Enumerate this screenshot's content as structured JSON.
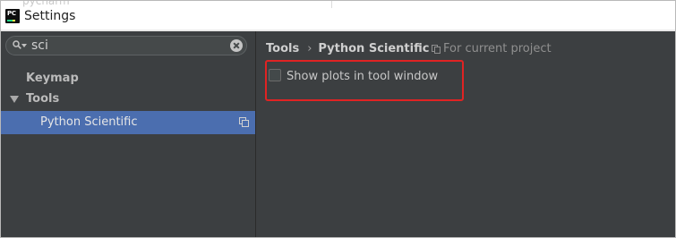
{
  "window": {
    "title": "Settings",
    "app_icon": "pycharm-logo-icon",
    "background_fragment": "pycharm"
  },
  "sidebar": {
    "search": {
      "value": "sci",
      "icons": [
        "search-icon",
        "clear-icon"
      ]
    },
    "items": [
      {
        "label": "Keymap",
        "bold": true,
        "level": 0
      },
      {
        "label": "Tools",
        "bold": true,
        "level": 0,
        "expanded": true
      },
      {
        "label": "Python Scientific",
        "bold": false,
        "level": 1,
        "selected": true,
        "has_copy_icon": true
      }
    ]
  },
  "content": {
    "breadcrumb": {
      "parent": "Tools",
      "separator": "›",
      "current": "Python Scientific"
    },
    "scope_label": "For current project",
    "setting": {
      "label": "Show plots in tool window",
      "checked": false
    }
  },
  "colors": {
    "panel_bg": "#3c3f41",
    "selection": "#4b6eaf",
    "highlight_border": "#e02323",
    "text": "#bbbbbb"
  }
}
